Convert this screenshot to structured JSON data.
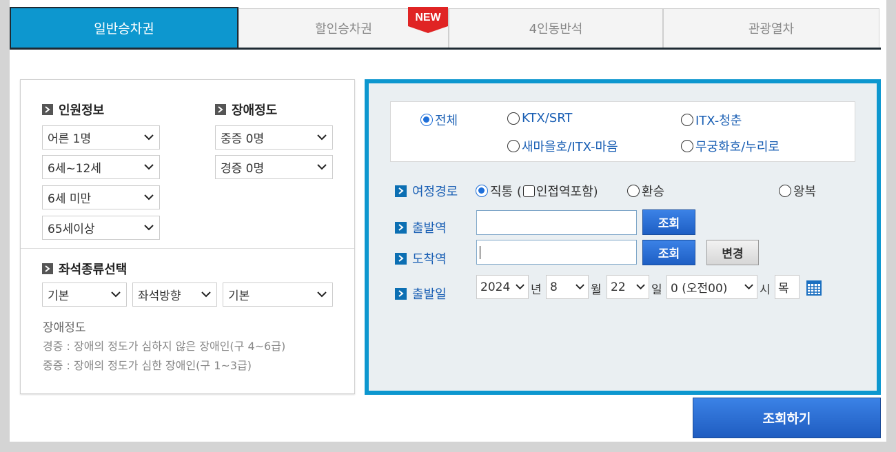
{
  "tabs": [
    {
      "label": "일반승차권",
      "active": true
    },
    {
      "label": "할인승차권",
      "active": false
    },
    {
      "label": "4인동반석",
      "active": false
    },
    {
      "label": "관광열차",
      "active": false
    }
  ],
  "new_badge": "NEW",
  "passengers": {
    "title": "인원정보",
    "adult": "어른 1명",
    "child": "6세~12세",
    "infant": "6세 미만",
    "senior": "65세이상"
  },
  "disability": {
    "title": "장애정도",
    "severe": "중증 0명",
    "mild": "경증 0명"
  },
  "seat": {
    "title": "좌석종류선택",
    "type": "기본",
    "direction": "좌석방향",
    "option": "기본"
  },
  "note": {
    "title": "장애정도",
    "line1": "경증 : 장애의 정도가 심하지 않은 장애인(구 4~6급)",
    "line2": "중증 : 장애의 정도가 심한 장애인(구 1~3급)"
  },
  "train_types": {
    "all": "전체",
    "ktx": "KTX/SRT",
    "itx_young": "ITX-청춘",
    "saemaeul": "새마을호/ITX-마음",
    "mugunghwa": "무궁화호/누리로"
  },
  "route": {
    "label": "여정경로",
    "direct": "직통 (",
    "nearby": "인접역포함)",
    "transfer": "환승",
    "round": "왕복"
  },
  "departure": {
    "label": "출발역",
    "value": "",
    "button": "조회"
  },
  "arrival": {
    "label": "도착역",
    "value": "",
    "button": "조회",
    "change_button": "변경"
  },
  "date": {
    "label": "출발일",
    "year": "2024",
    "year_unit": "년",
    "month": "8",
    "month_unit": "월",
    "day": "22",
    "day_unit": "일",
    "hour": "0 (오전00)",
    "hour_unit": "시",
    "weekday": "목"
  },
  "search_button": "조회하기",
  "colors": {
    "accent": "#0d97cf",
    "button_blue": "#2a6fd6",
    "link_blue": "#1a5fb4"
  }
}
